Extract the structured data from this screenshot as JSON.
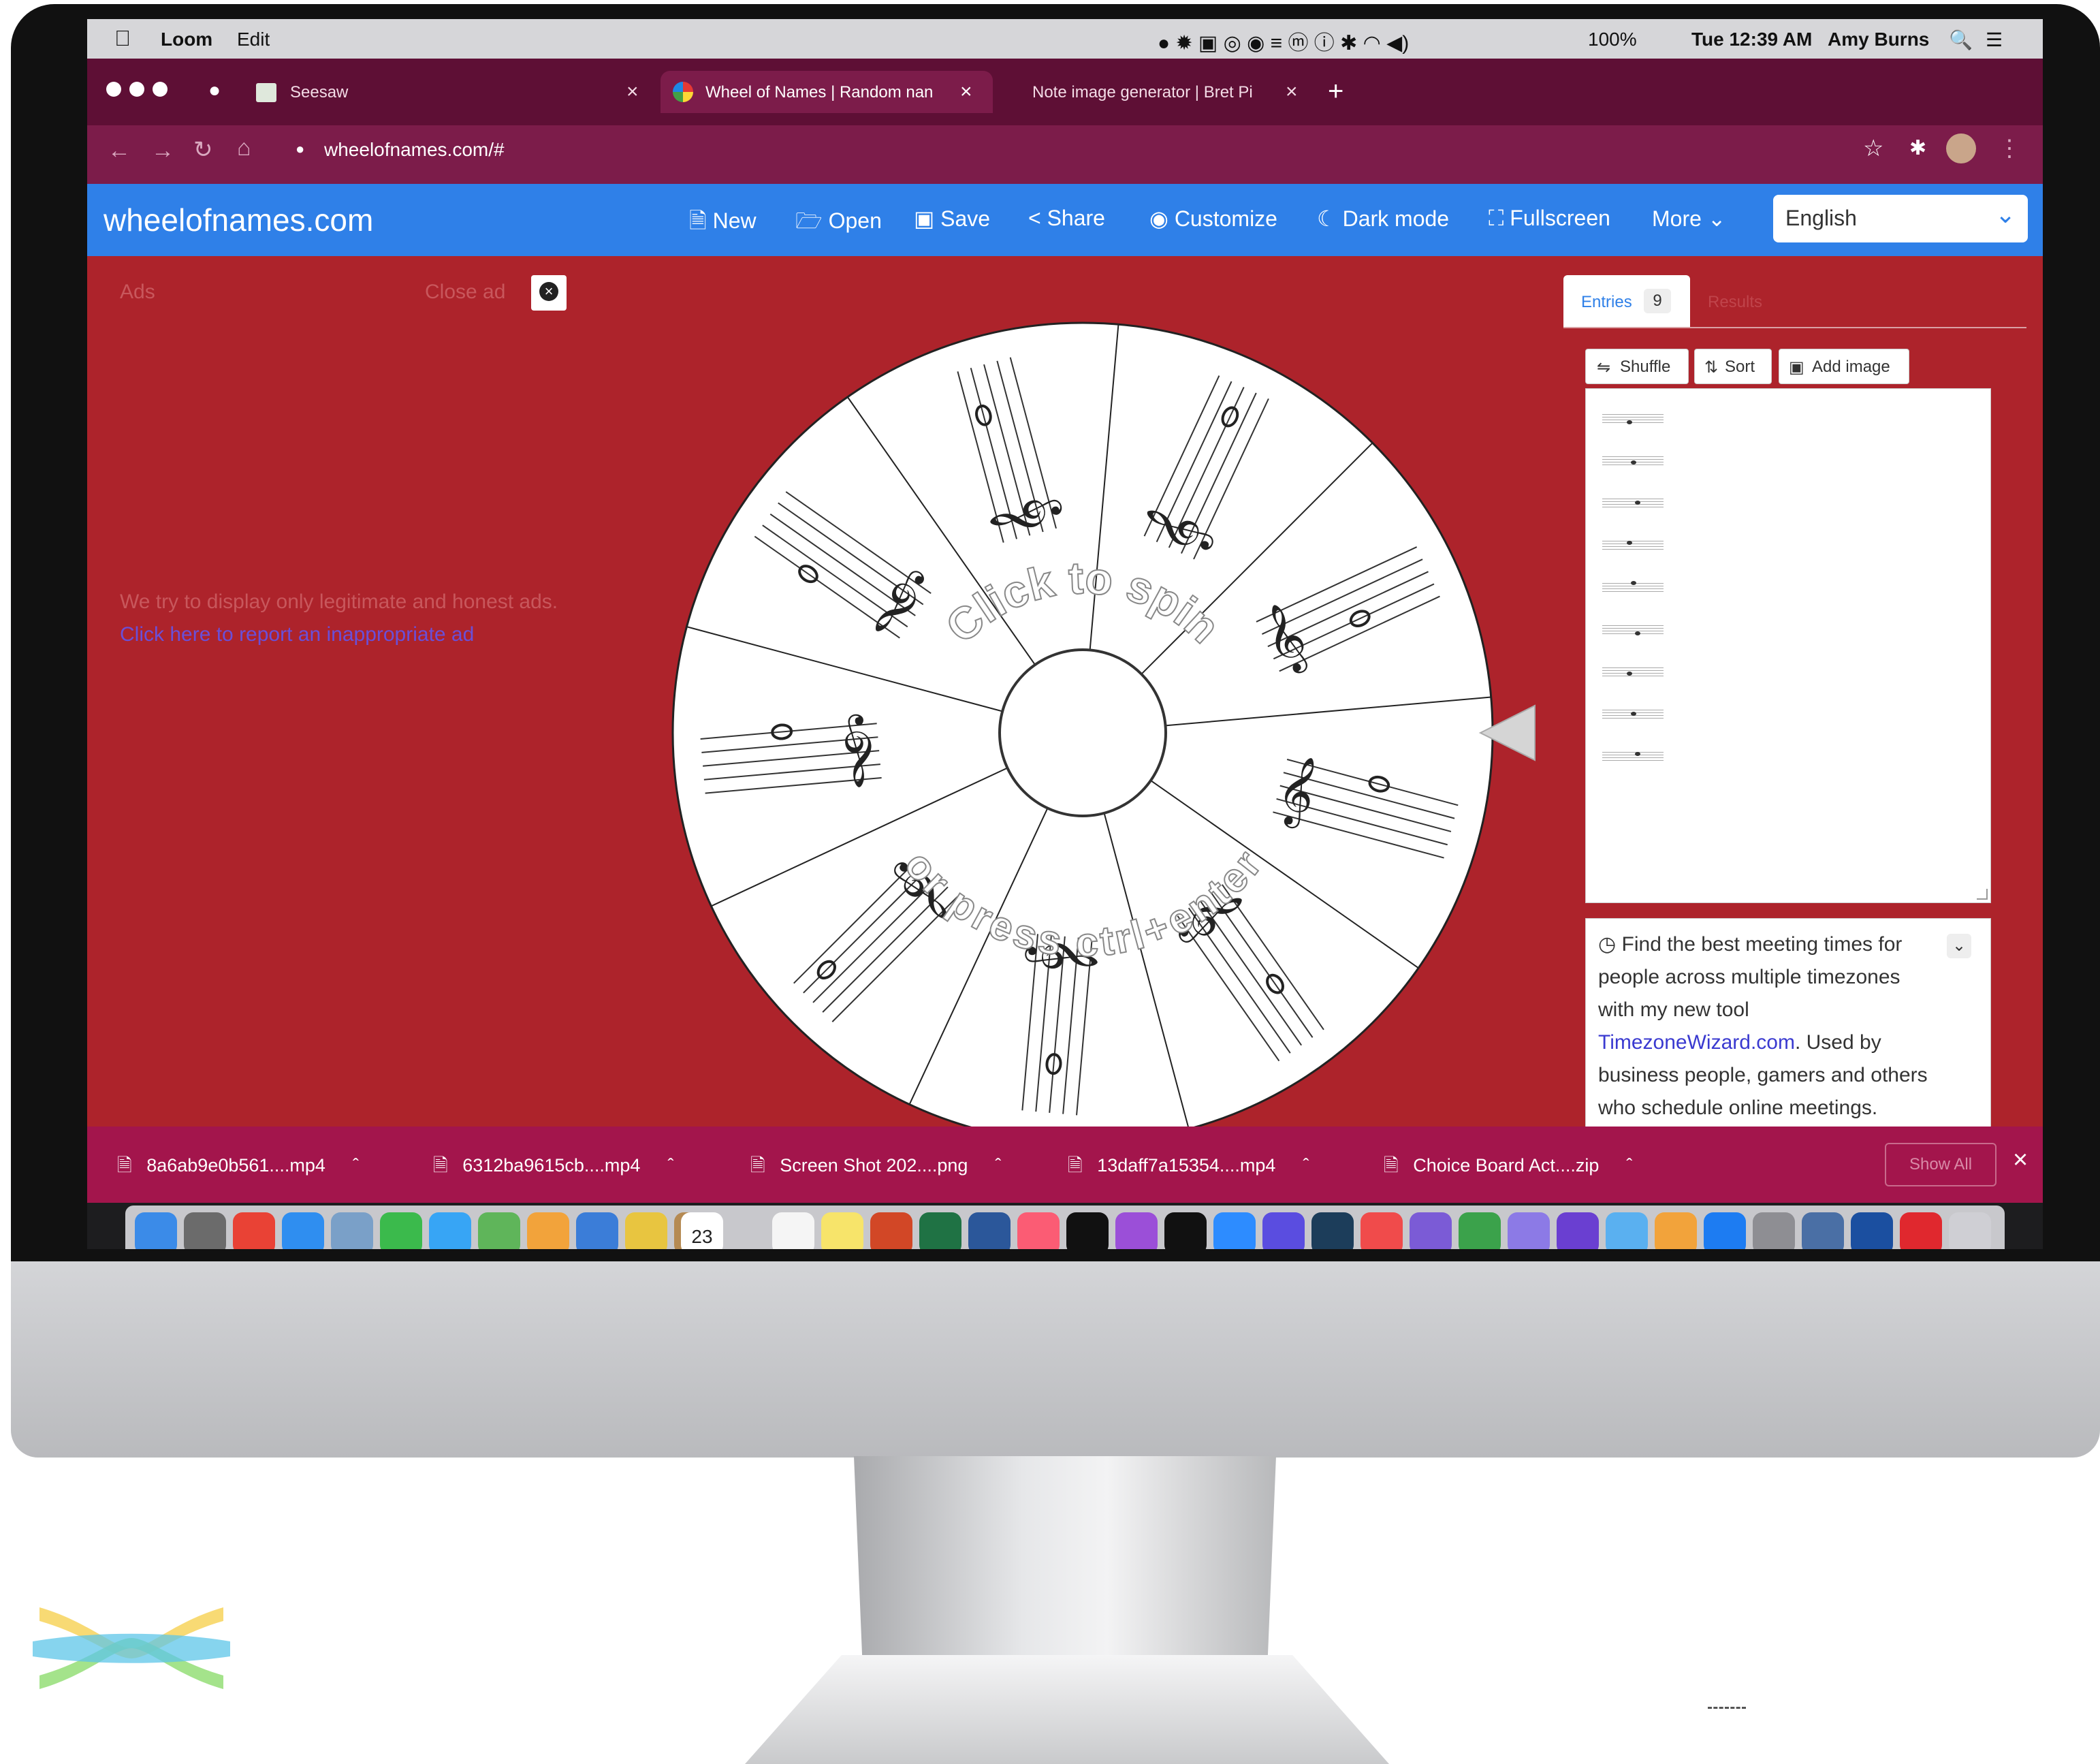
{
  "menubar": {
    "app_name": "Loom",
    "menu_edit": "Edit",
    "battery": "100%",
    "clock": "Tue 12:39 AM",
    "user": "Amy Burns"
  },
  "tabs": [
    {
      "title": "Seesaw"
    },
    {
      "title": "Wheel of Names | Random nan"
    },
    {
      "title": "Note image generator | Bret Pi"
    }
  ],
  "address": {
    "url": "wheelofnames.com/#"
  },
  "site": {
    "logo": "wheelofnames.com",
    "nav": {
      "new": "New",
      "open": "Open",
      "save": "Save",
      "share": "Share",
      "customize": "Customize",
      "dark_mode": "Dark mode",
      "fullscreen": "Fullscreen",
      "more": "More"
    },
    "language": "English"
  },
  "ads": {
    "label": "Ads",
    "close": "Close ad",
    "notice": "We try to display only legitimate and honest ads.",
    "report_link": "Click here to report an inappropriate ad"
  },
  "wheel": {
    "prompt_top": "Click to spin",
    "prompt_bottom": "or press ctrl+enter",
    "segment_count": 9,
    "colors": {
      "background": "#ad232b",
      "segment": "#ffffff",
      "line": "#222222"
    }
  },
  "entries": {
    "tab_label": "Entries",
    "count": "9",
    "results_label": "Results",
    "shuffle": "Shuffle",
    "sort": "Sort",
    "add_image": "Add image"
  },
  "promo": {
    "text_before": "Find the best meeting times for people across multiple timezones with my new tool",
    "link": "TimezoneWizard.com",
    "text_after": ". Used by business people, gamers and others who schedule online meetings."
  },
  "downloads": {
    "items": [
      {
        "name": "8a6ab9e0b561....mp4"
      },
      {
        "name": "6312ba9615cb....mp4"
      },
      {
        "name": "Screen Shot 202....png"
      },
      {
        "name": "13daff7a15354....mp4"
      },
      {
        "name": "Choice Board Act....zip"
      }
    ],
    "show_all": "Show All"
  },
  "dock": {
    "calendar_day": "23"
  },
  "colors": {
    "site_blue": "#2f80e8",
    "page_red": "#ad232b",
    "tab_bar": "#5e0f35",
    "downloads_bar": "#a3154c",
    "link": "#3a3ad0"
  }
}
